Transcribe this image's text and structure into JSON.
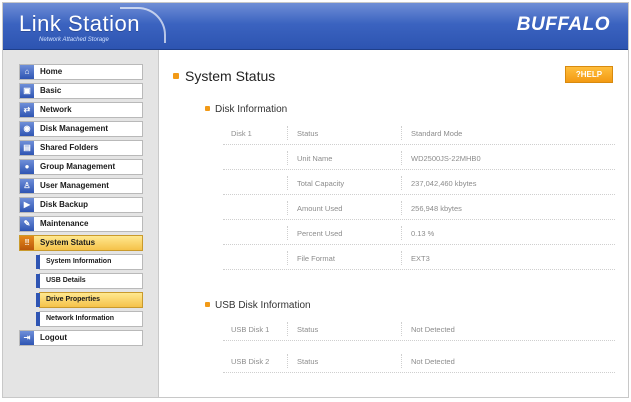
{
  "header": {
    "logo_title": "Link Station",
    "logo_subtitle": "Network Attached Storage",
    "brand": "BUFFALO"
  },
  "sidebar": {
    "items": [
      {
        "label": "Home",
        "icon": "home-icon"
      },
      {
        "label": "Basic",
        "icon": "basic-icon"
      },
      {
        "label": "Network",
        "icon": "network-icon"
      },
      {
        "label": "Disk Management",
        "icon": "disk-icon"
      },
      {
        "label": "Shared Folders",
        "icon": "folder-icon"
      },
      {
        "label": "Group Management",
        "icon": "group-icon"
      },
      {
        "label": "User Management",
        "icon": "user-icon"
      },
      {
        "label": "Disk Backup",
        "icon": "backup-icon"
      },
      {
        "label": "Maintenance",
        "icon": "maintenance-icon"
      },
      {
        "label": "System Status",
        "icon": "status-icon"
      }
    ],
    "subitems": [
      {
        "label": "System Information"
      },
      {
        "label": "USB Details"
      },
      {
        "label": "Drive Properties"
      },
      {
        "label": "Network Information"
      }
    ],
    "logout": {
      "label": "Logout",
      "icon": "logout-icon"
    }
  },
  "main": {
    "title": "System Status",
    "help_label": "?HELP",
    "disk_info_title": "Disk Information",
    "disk_label": "Disk 1",
    "disk_rows": [
      {
        "key": "Status",
        "value": "Standard Mode"
      },
      {
        "key": "Unit Name",
        "value": "WD2500JS-22MHB0"
      },
      {
        "key": "Total Capacity",
        "value": "237,042,460 kbytes"
      },
      {
        "key": "Amount Used",
        "value": "256,948 kbytes"
      },
      {
        "key": "Percent Used",
        "value": "0.13 %"
      },
      {
        "key": "File Format",
        "value": "EXT3"
      }
    ],
    "usb_info_title": "USB Disk Information",
    "usb_rows": [
      {
        "disk": "USB Disk 1",
        "key": "Status",
        "value": "Not Detected"
      },
      {
        "disk": "USB Disk 2",
        "key": "Status",
        "value": "Not Detected"
      }
    ]
  },
  "colors": {
    "header_blue": "#2d54b1",
    "accent_orange": "#f29a17",
    "active_yellow": "#f5c24a"
  }
}
